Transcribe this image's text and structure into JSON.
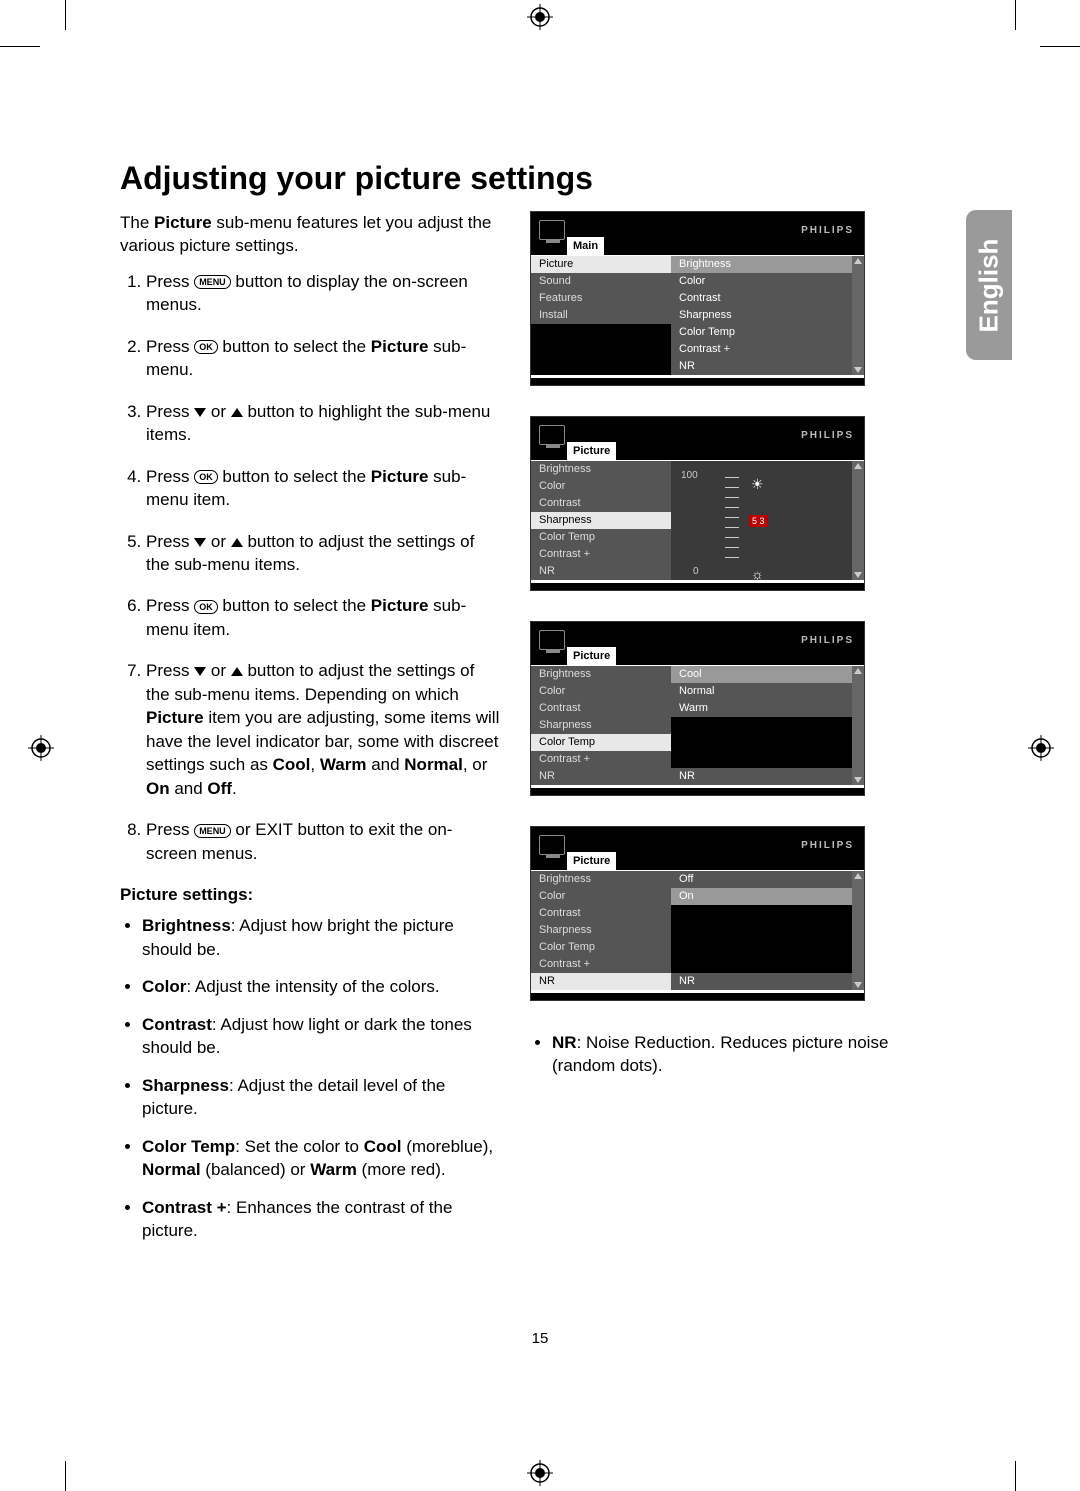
{
  "title": "Adjusting your picture settings",
  "language_tab": "English",
  "page_number": "15",
  "intro_pre": "The ",
  "intro_bold": "Picture",
  "intro_post": " sub-menu features let you adjust the various picture settings.",
  "steps": {
    "s1_a": "Press ",
    "s1_menu": "MENU",
    "s1_b": " button to display the on-screen menus.",
    "s2_a": "Press ",
    "s2_ok": "OK",
    "s2_b": " button to select the ",
    "s2_bold": "Picture",
    "s2_c": " sub-menu.",
    "s3_a": "Press ",
    "s3_b": " or ",
    "s3_c": " button to highlight the sub-menu items.",
    "s4_a": "Press ",
    "s4_ok": "OK",
    "s4_b": " button to select the ",
    "s4_bold": "Picture",
    "s4_c": " sub-menu item.",
    "s5_a": "Press ",
    "s5_b": " or ",
    "s5_c": " button to adjust the settings of the sub-menu items.",
    "s6_a": "Press ",
    "s6_ok": "OK",
    "s6_b": " button to select the ",
    "s6_bold": "Picture",
    "s6_c": " sub-menu item.",
    "s7_a": "Press ",
    "s7_b": " or ",
    "s7_c": " button to adjust the settings of the sub-menu items. Depending on which ",
    "s7_bold1": "Picture",
    "s7_d": " item you are adjusting, some items will have the level indicator bar, some with discreet settings such as ",
    "s7_bold2": "Cool",
    "s7_e": ", ",
    "s7_bold3": "Warm",
    "s7_f": " and ",
    "s7_bold4": "Normal",
    "s7_g": ", or ",
    "s7_bold5": "On",
    "s7_h": " and ",
    "s7_bold6": "Off",
    "s7_i": ".",
    "s8_a": "Press ",
    "s8_menu": "MENU",
    "s8_b": " or EXIT button to exit the on-screen menus."
  },
  "settings_head": "Picture settings:",
  "settings": {
    "brightness_b": "Brightness",
    "brightness_t": ": Adjust how bright the picture should be.",
    "color_b": "Color",
    "color_t": ": Adjust the intensity of the colors.",
    "contrast_b": "Contrast",
    "contrast_t": ": Adjust how light or dark the tones should be.",
    "sharpness_b": "Sharpness",
    "sharpness_t": ": Adjust the detail level of the picture.",
    "colortemp_b": "Color Temp",
    "colortemp_t1": ": Set the color to ",
    "colortemp_cool": "Cool",
    "colortemp_t2": " (moreblue), ",
    "colortemp_normal": "Normal",
    "colortemp_t3": " (balanced) or ",
    "colortemp_warm": "Warm",
    "colortemp_t4": " (more red).",
    "contrastp_b": "Contrast +",
    "contrastp_t": ": Enhances the contrast of the picture.",
    "nr_b": "NR",
    "nr_t": ": Noise Reduction. Reduces picture noise (random dots)."
  },
  "osd": {
    "brand": "PHILIPS",
    "menu1": {
      "crumb": "Main",
      "left": [
        "Picture",
        "Sound",
        "Features",
        "Install"
      ],
      "right": [
        "Brightness",
        "Color",
        "Contrast",
        "Sharpness",
        "Color Temp",
        "Contrast +",
        "NR"
      ]
    },
    "menu2": {
      "crumb": "Picture",
      "left": [
        "Brightness",
        "Color",
        "Contrast",
        "Sharpness",
        "Color Temp",
        "Contrast +",
        "NR"
      ],
      "slider_top": "100",
      "slider_bot": "0",
      "slider_marker": "5 3"
    },
    "menu3": {
      "crumb": "Picture",
      "left": [
        "Brightness",
        "Color",
        "Contrast",
        "Sharpness",
        "Color Temp",
        "Contrast +",
        "NR"
      ],
      "right": [
        "Cool",
        "Normal",
        "Warm",
        "",
        "",
        "",
        "NR"
      ]
    },
    "menu4": {
      "crumb": "Picture",
      "left": [
        "Brightness",
        "Color",
        "Contrast",
        "Sharpness",
        "Color Temp",
        "Contrast +",
        "NR"
      ],
      "right": [
        "Off",
        "On",
        "",
        "",
        "",
        "",
        "NR"
      ]
    }
  }
}
